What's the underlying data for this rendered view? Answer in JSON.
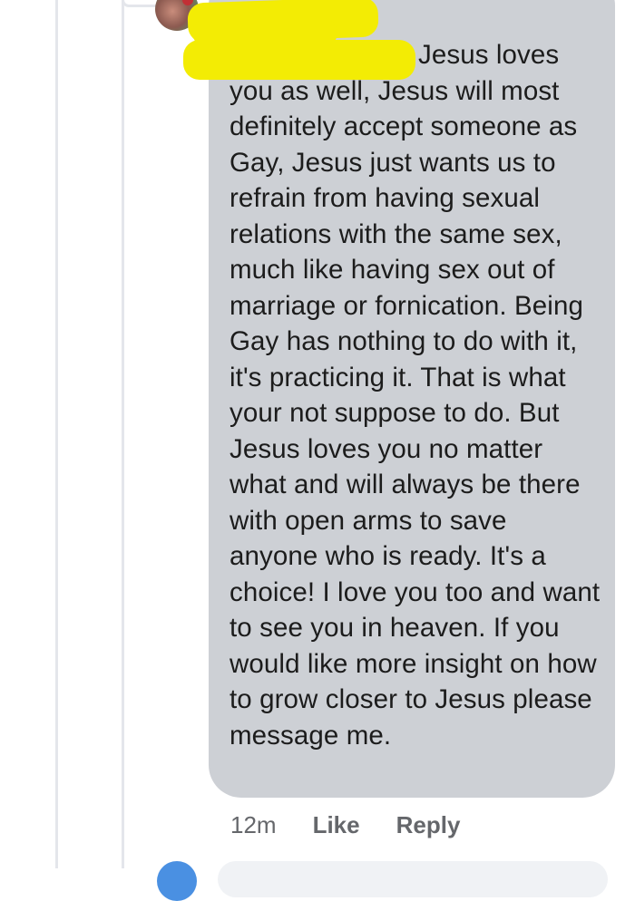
{
  "comment": {
    "author_name_visible_fragment": "Jesus loves",
    "body": "Jesus loves you as well, Jesus will most definitely accept someone as Gay, Jesus just wants us to refrain from having sexual relations with the same sex, much like having sex out of marriage or fornication. Being Gay has nothing to do with it, it's practicing it. That is what your not suppose to do. But Jesus loves you no matter what and will always be there with open arms to save anyone who is ready. It's a choice! I love you too and want to see you in heaven. If you would like more insight on how to grow closer to Jesus please message me.",
    "timestamp": "12m",
    "like_label": "Like",
    "reply_label": "Reply"
  },
  "colors": {
    "bubble": "#cdd0d5",
    "redaction": "#f3ec04",
    "meta_text": "#65676b",
    "thread_line": "#e4e6eb"
  }
}
